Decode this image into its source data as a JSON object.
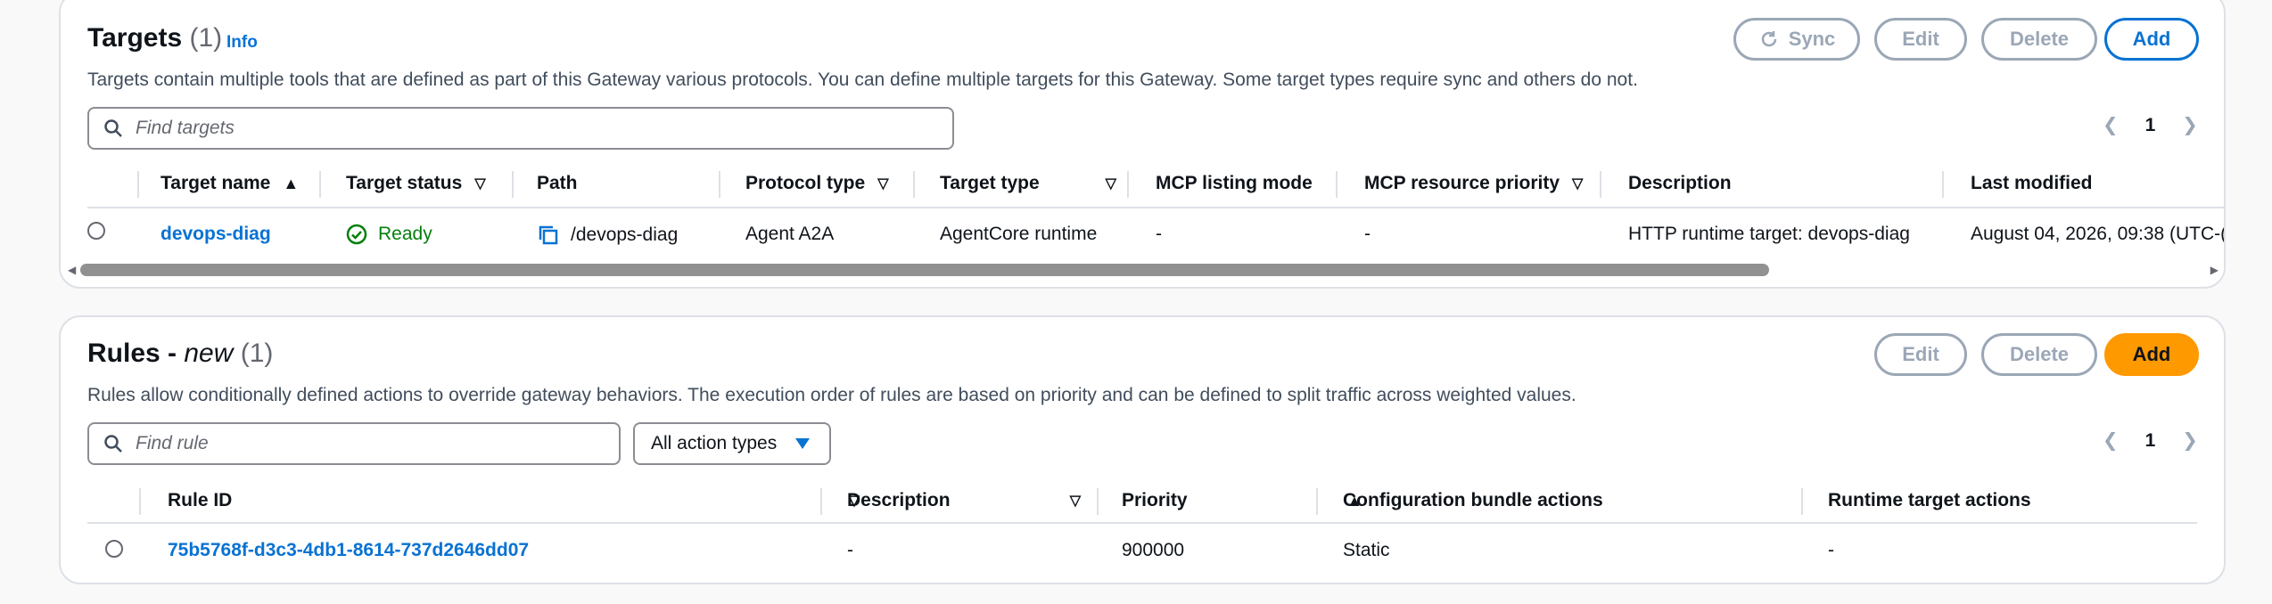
{
  "targets": {
    "title": "Targets",
    "count": "(1)",
    "info_link": "Info",
    "description": "Targets contain multiple tools that are defined as part of this Gateway various protocols. You can define multiple targets for this Gateway. Some target types require sync and others do not.",
    "buttons": {
      "sync": "Sync",
      "edit": "Edit",
      "delete": "Delete",
      "add": "Add"
    },
    "search_placeholder": "Find targets",
    "page": "1",
    "columns": [
      "Target name",
      "Target status",
      "Path",
      "Protocol type",
      "Target type",
      "MCP listing mode",
      "MCP resource priority",
      "Description",
      "Last modified"
    ],
    "rows": [
      {
        "name": "devops-diag",
        "status": "Ready",
        "path": "/devops-diag",
        "protocol": "Agent A2A",
        "type": "AgentCore runtime",
        "listing_mode": "-",
        "resource_priority": "-",
        "description": "HTTP runtime target: devops-diag",
        "last_modified": "August 04, 2026, 09:38 (UTC-("
      }
    ]
  },
  "rules": {
    "title": "Rules - ",
    "title_em": "new",
    "count": "(1)",
    "description": "Rules allow conditionally defined actions to override gateway behaviors. The execution order of rules are based on priority and can be defined to split traffic across weighted values.",
    "buttons": {
      "edit": "Edit",
      "delete": "Delete",
      "add": "Add"
    },
    "search_placeholder": "Find rule",
    "filter_select": "All action types",
    "page": "1",
    "columns": [
      "Rule ID",
      "Description",
      "Priority",
      "Configuration bundle actions",
      "Runtime target actions"
    ],
    "rows": [
      {
        "id": "75b5768f-d3c3-4db1-8614-737d2646dd07",
        "description": "-",
        "priority": "900000",
        "config_actions": "Static",
        "runtime_actions": "-"
      }
    ]
  },
  "colors": {
    "link": "#0972d3",
    "success": "#037f0c",
    "primary_orange": "#ff9900",
    "disabled": "#9ba7b6"
  }
}
